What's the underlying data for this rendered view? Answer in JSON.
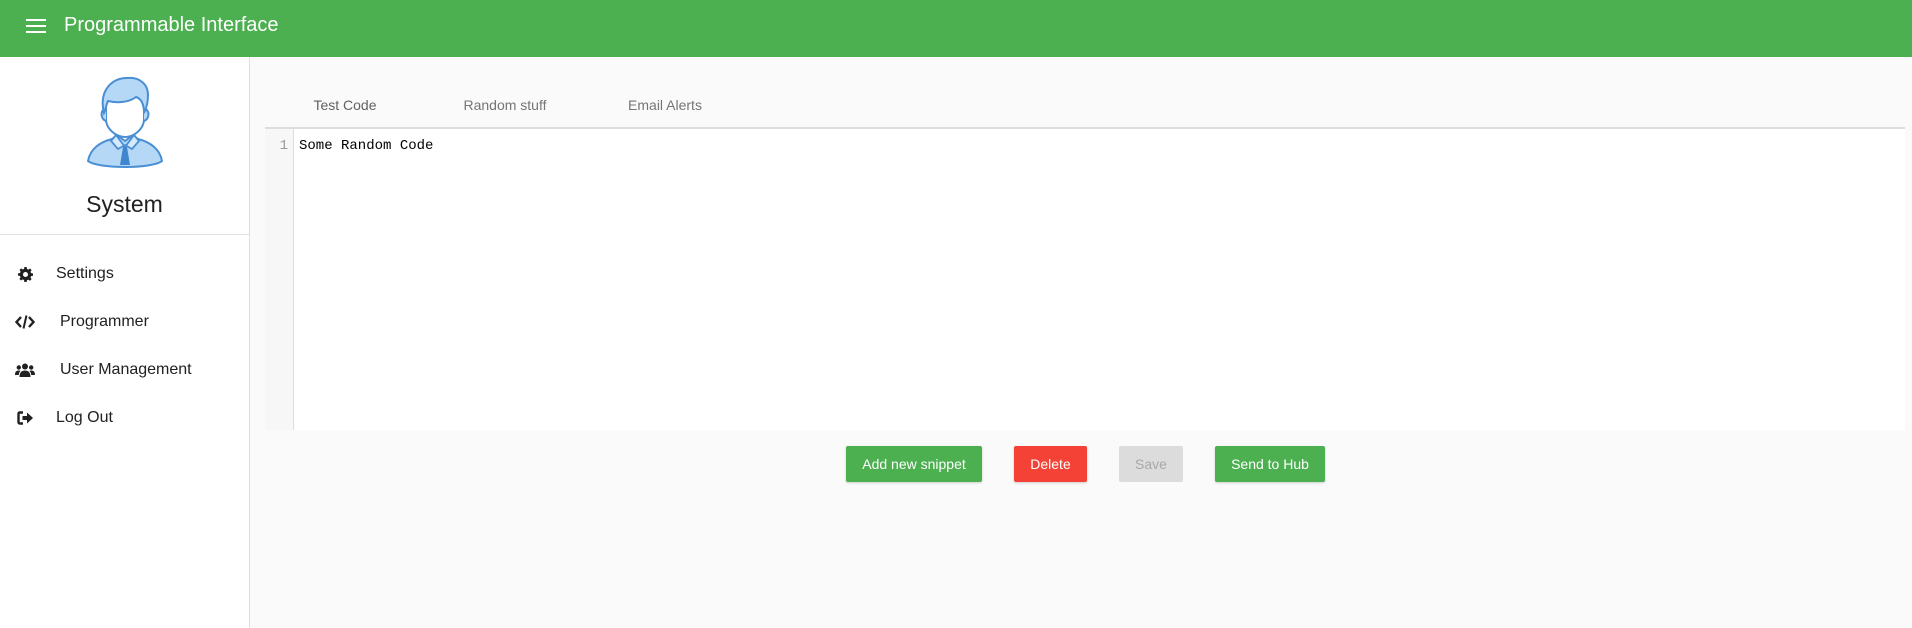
{
  "header": {
    "menu_icon": "hamburger-menu-icon",
    "title": "Programmable Interface",
    "color": "#4caf50"
  },
  "sidebar": {
    "profile": {
      "avatar_icon": "user-avatar-icon",
      "name": "System"
    },
    "items": [
      {
        "icon": "gear-icon",
        "label": "Settings"
      },
      {
        "icon": "code-icon",
        "label": "Programmer"
      },
      {
        "icon": "users-icon",
        "label": "User Management"
      },
      {
        "icon": "sign-out-icon",
        "label": "Log Out"
      }
    ]
  },
  "main": {
    "tabs": [
      {
        "label": "Test Code",
        "active": true
      },
      {
        "label": "Random stuff",
        "active": false
      },
      {
        "label": "Email Alerts",
        "active": false
      }
    ],
    "editor": {
      "lines": [
        {
          "number": "1",
          "text": "Some Random Code"
        }
      ]
    },
    "actions": {
      "add_label": "Add new snippet",
      "delete_label": "Delete",
      "save_label": "Save",
      "save_disabled": true,
      "send_label": "Send to Hub"
    }
  },
  "colors": {
    "accent": "#4caf50",
    "danger": "#f44336",
    "disabled": "#dcdcdc"
  }
}
